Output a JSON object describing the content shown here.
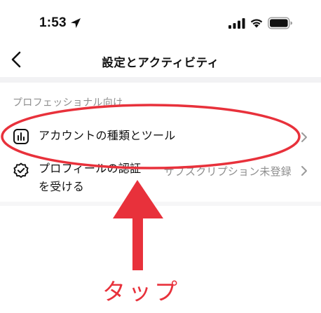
{
  "status_bar": {
    "time": "1:53"
  },
  "header": {
    "title": "設定とアクティビティ"
  },
  "section": {
    "title": "プロフェッショナル向け",
    "items": [
      {
        "label": "アカウントの種類とツール",
        "icon": "bar-chart-icon"
      },
      {
        "label_line1": "プロフィールの認証",
        "label_line2": "を受ける",
        "value": "サブスクリプション未登録",
        "icon": "verified-badge-icon"
      }
    ]
  },
  "annotation": {
    "label": "タップ",
    "color": "#e8313b"
  },
  "colors": {
    "accent_red": "#e8313b",
    "secondary_text": "#8e8e8e",
    "divider": "#f2f2f4"
  }
}
